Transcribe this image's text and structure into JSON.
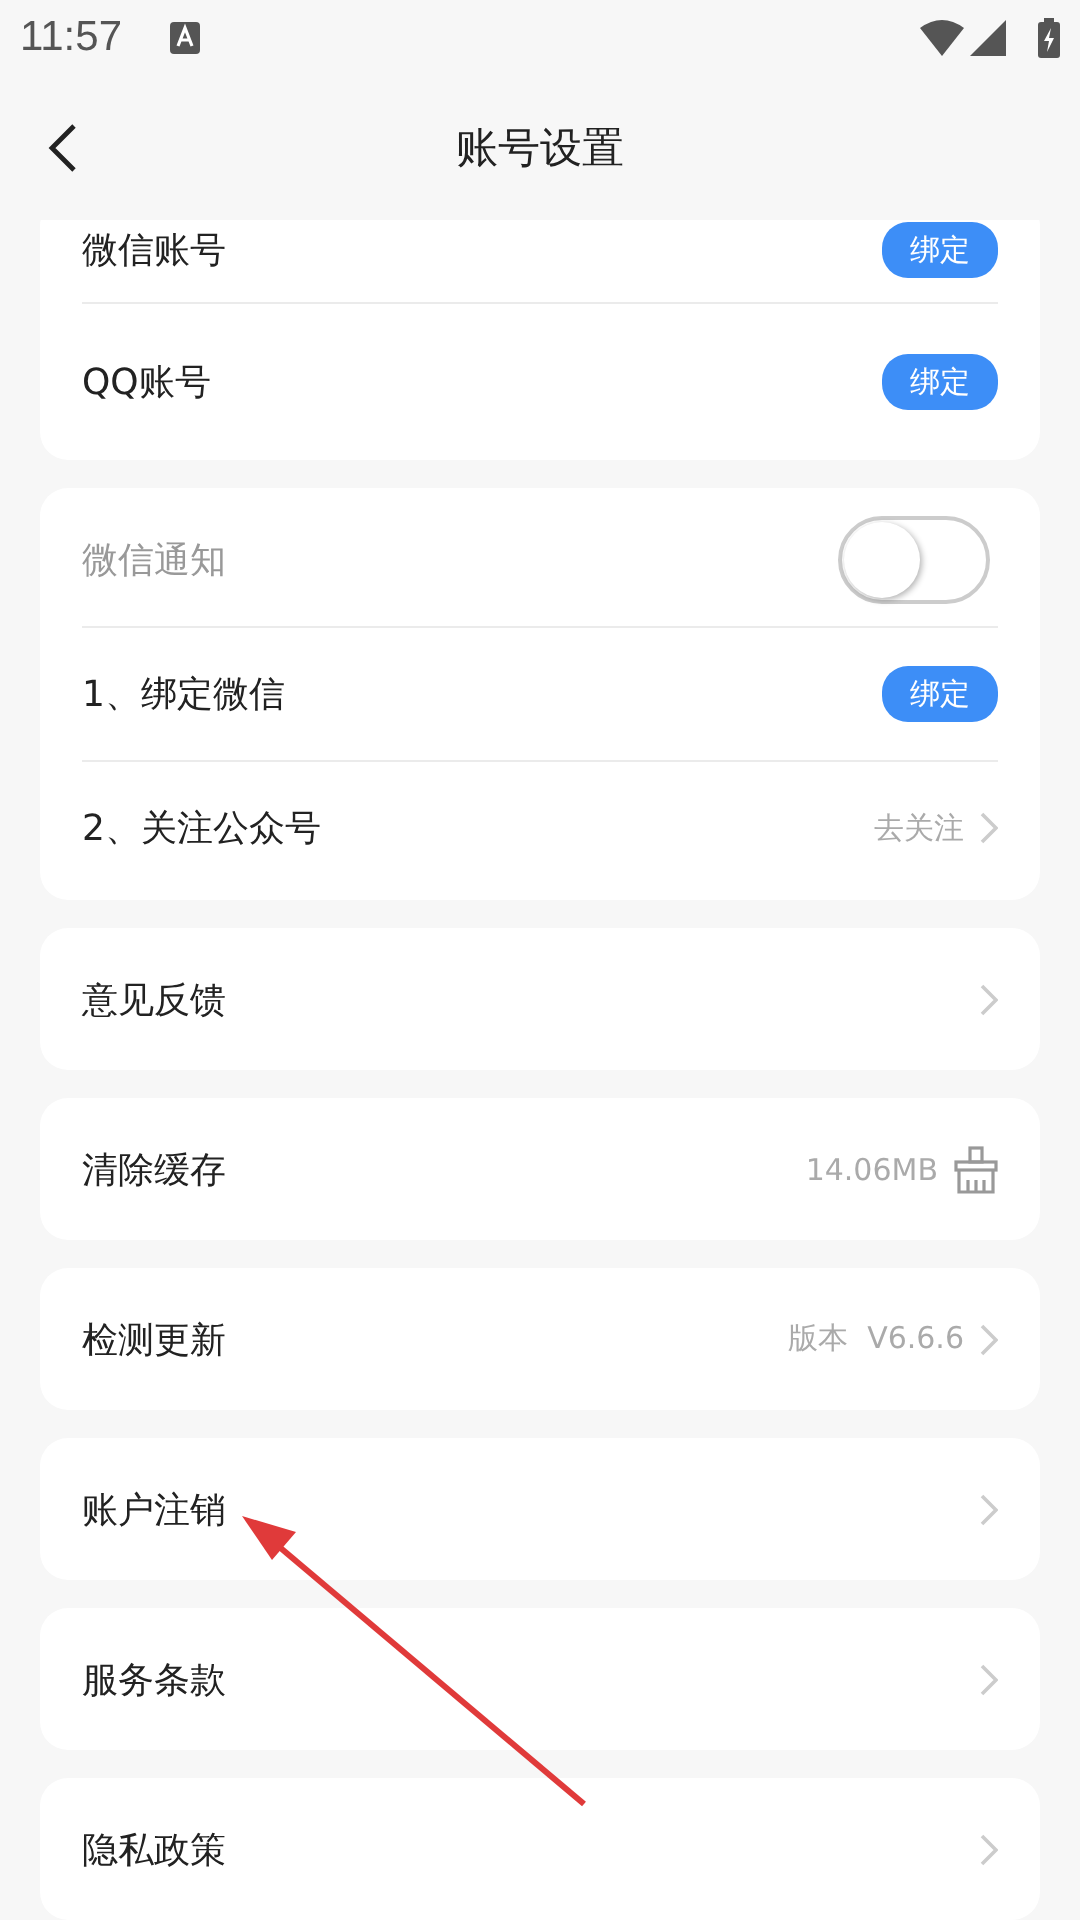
{
  "status_bar": {
    "time": "11:57"
  },
  "header": {
    "title": "账号设置"
  },
  "groups": [
    {
      "rows": [
        {
          "kind": "button",
          "label": "微信账号",
          "button": "绑定"
        },
        {
          "kind": "button",
          "label": "QQ账号",
          "button": "绑定"
        }
      ]
    },
    {
      "rows": [
        {
          "kind": "toggle",
          "label": "微信通知",
          "on": false,
          "disabled": true
        },
        {
          "kind": "button",
          "label": "1、绑定微信",
          "button": "绑定"
        },
        {
          "kind": "link",
          "label": "2、关注公众号",
          "value": "去关注"
        }
      ]
    },
    {
      "rows": [
        {
          "kind": "link",
          "label": "意见反馈"
        }
      ]
    },
    {
      "rows": [
        {
          "kind": "clear",
          "label": "清除缓存",
          "value": "14.06MB"
        }
      ]
    },
    {
      "rows": [
        {
          "kind": "link",
          "label": "检测更新",
          "value": "版本  V6.6.6"
        }
      ]
    },
    {
      "rows": [
        {
          "kind": "link",
          "label": "账户注销"
        }
      ]
    },
    {
      "rows": [
        {
          "kind": "link",
          "label": "服务条款"
        }
      ]
    },
    {
      "rows": [
        {
          "kind": "link",
          "label": "隐私政策"
        }
      ]
    }
  ]
}
